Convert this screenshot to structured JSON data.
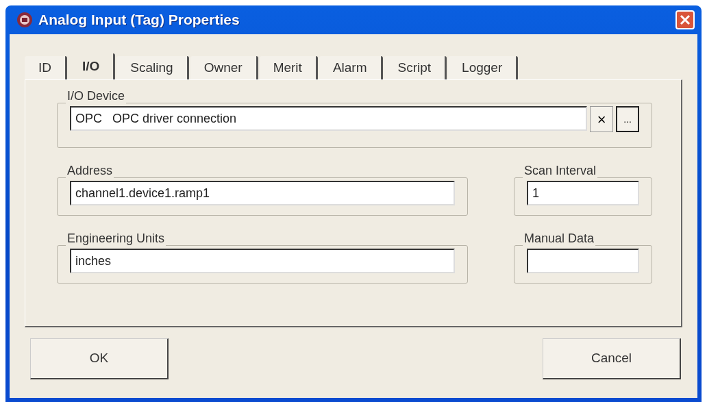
{
  "window": {
    "title": "Analog Input (Tag) Properties"
  },
  "tabs": [
    {
      "label": "ID",
      "selected": false
    },
    {
      "label": "I/O",
      "selected": true
    },
    {
      "label": "Scaling",
      "selected": false
    },
    {
      "label": "Owner",
      "selected": false
    },
    {
      "label": "Merit",
      "selected": false
    },
    {
      "label": "Alarm",
      "selected": false
    },
    {
      "label": "Script",
      "selected": false
    },
    {
      "label": "Logger",
      "selected": false
    }
  ],
  "io_device": {
    "label": "I/O Device",
    "value": "OPC   OPC driver connection",
    "clear_button": "×",
    "browse_button": "..."
  },
  "fields": [
    {
      "label": "Address",
      "value": "channel1.device1.ramp1"
    },
    {
      "label": "Scan Interval",
      "value": "1"
    },
    {
      "label": "Engineering Units",
      "value": "inches"
    },
    {
      "label": "Manual Data"
    }
  ],
  "buttons": [
    "OK",
    "Cancel"
  ]
}
